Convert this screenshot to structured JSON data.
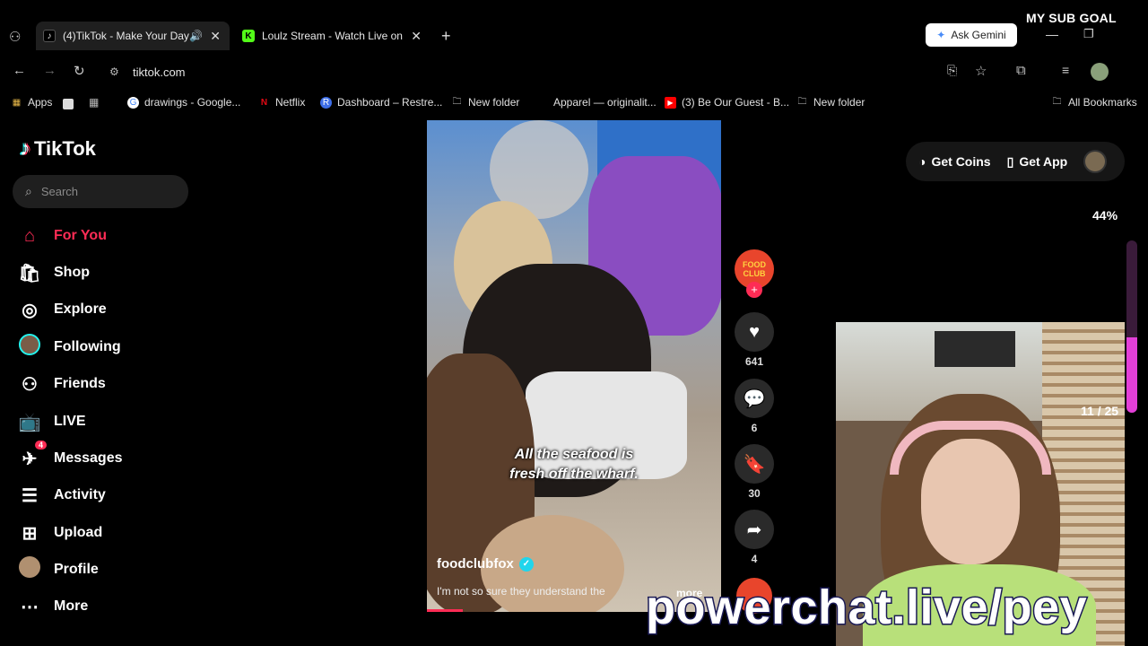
{
  "browser": {
    "tabs": [
      {
        "title": "(4)TikTok - Make Your Day",
        "active": true
      },
      {
        "title": "Loulz Stream - Watch Live on K",
        "active": false
      }
    ],
    "ask_gemini": "Ask Gemini",
    "url": "tiktok.com",
    "bookmarks": [
      "Apps",
      "drawings - Google...",
      "Netflix",
      "Dashboard – Restre...",
      "New folder",
      "Apparel — originalit...",
      "(3) Be Our Guest - B...",
      "New folder",
      "All Bookmarks"
    ]
  },
  "overlay": {
    "sub_goal": "MY SUB GOAL",
    "percent": "44%",
    "progress": 0.44,
    "counter": "11 / 25",
    "watermark": "powerchat.live/pey"
  },
  "tiktok": {
    "logo": "TikTok",
    "search_placeholder": "Search",
    "nav": [
      {
        "label": "For You",
        "icon": "home-icon",
        "active": true
      },
      {
        "label": "Shop",
        "icon": "shop-icon"
      },
      {
        "label": "Explore",
        "icon": "compass-icon"
      },
      {
        "label": "Following",
        "icon": "avatar-icon"
      },
      {
        "label": "Friends",
        "icon": "friends-icon"
      },
      {
        "label": "LIVE",
        "icon": "live-icon"
      },
      {
        "label": "Messages",
        "icon": "messages-icon",
        "badge": "4"
      },
      {
        "label": "Activity",
        "icon": "activity-icon"
      },
      {
        "label": "Upload",
        "icon": "upload-icon"
      },
      {
        "label": "Profile",
        "icon": "avatar-icon"
      },
      {
        "label": "More",
        "icon": "more-icon"
      }
    ],
    "get_coins": "Get Coins",
    "get_app": "Get App",
    "video": {
      "caption_line1": "All the seafood is",
      "caption_line2": "fresh off the wharf.",
      "author": "foodclubfox",
      "description": "I'm not so sure they understand the",
      "more": "more",
      "channel_badge": "FOOD CLUB"
    },
    "actions": {
      "likes": "641",
      "comments": "6",
      "saves": "30",
      "shares": "4"
    }
  },
  "colors": {
    "accent": "#fe2c55",
    "progress": "#e33fd8"
  }
}
